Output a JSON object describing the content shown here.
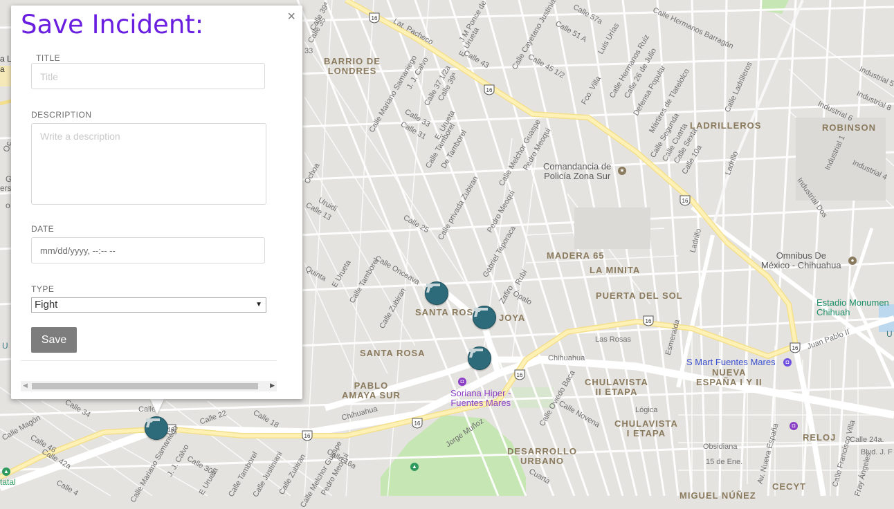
{
  "form": {
    "title": "Save Incident:",
    "close_glyph": "×",
    "title_field": {
      "label": "TITLE",
      "placeholder": "Title"
    },
    "description_field": {
      "label": "DESCRIPTION",
      "placeholder": "Write a description"
    },
    "date_field": {
      "label": "DATE",
      "placeholder": "mm/dd/yyyy, --:-- --"
    },
    "type_field": {
      "label": "TYPE",
      "selected": "Fight"
    },
    "save_label": "Save"
  },
  "markers": {
    "icon": "gun-icon",
    "count": 4,
    "color": "#2e6b7a"
  },
  "map_labels": {
    "neighborhoods": {
      "barrio_de_londres": "BARRIO DE\nLONDRES",
      "ladrilleros": "LADRILLEROS",
      "robinson": "ROBINSON",
      "madera_65": "MADERA 65",
      "la_minita": "LA MINITA",
      "puerta_del_sol": "PUERTA DEL SOL",
      "santa_rosa_1": "SANTA ROSA",
      "joya": "JOYA",
      "santa_rosa_2": "SANTA ROSA",
      "pablo_amaya_sur": "PABLO\nAMAYA SUR",
      "chulavista_ii": "CHULAVISTA\nII ETAPA",
      "chulavista_i": "CHULAVISTA\nI ETAPA",
      "nueva_espana": "NUEVA\nESPAÑA I Y II",
      "desarrollo_urbano": "DESARROLLO\nURBANO",
      "reloj": "RELOJ",
      "cecyt": "CECYT",
      "miguel_nunez": "MIGUEL NÚÑEZ"
    },
    "pois": {
      "comandancia": "Comandancia de\nPolicía Zona Sur",
      "omnibus": "Omnibus De\nMéxico - Chihuahua",
      "estadio": "Estadio Monumen\nChihuah",
      "smart": "S Mart Fuentes Mares",
      "soriana": "Soriana Hiper -\nFuentes Mares"
    },
    "streets": {
      "lat_pacheco": "Lat. Pacheco",
      "calle_39": "Calle 39ª",
      "jm_ponce": "J M Ponce de",
      "e_urueta_top": "E. Urueta",
      "calle_43": "Calle 43",
      "calle_cayetano": "Calle Cayetano Justiniani",
      "calle_45": "Calle 45 1/2",
      "calle_57": "Calle 57a",
      "calle_51a": "Calle 51 A",
      "luis_urias": "Luis Urías",
      "calle_hermanos_ruiz": "Calle Hermanos Ruiz",
      "calle_hermanos_barragan": "Calle Hermanos Barragán",
      "calle_26_julio": "Calle 26 de Julio",
      "defensa_popular": "Defensa Popular",
      "martires": "Mártires de Tlatelolco",
      "fco_villa": "Fco. Villa",
      "calle_mariano": "Calle Mariano Samaniego",
      "j_j_calvo": "J. J. Calvo",
      "calle_37": "Calle 37 1/2a",
      "calle_33": "Calle 33",
      "calle_31": "Calle 31",
      "calle_tamborel": "Calle Tamborel",
      "de_tamborel": "De Tamborel",
      "calle_melchor": "Calle Melchor Guaspe",
      "pedro_meoqui": "Pedro Meoqui",
      "calle_privada": "Calle privada Zubiran",
      "calle_25": "Calle 25",
      "gabriel_teporaca": "Gabriel Teporaca",
      "uruidi": "Uruidi",
      "calle_13": "Calle 13",
      "ochoa": "Ochoa",
      "quinta": "Quinta",
      "calle_onceava": "Calle Onceava",
      "calle_zubiran": "Calle Zubiran",
      "zafiro": "Zafiro",
      "opalo": "Ópalo",
      "rubi": "Rubí",
      "las_rosas": "Las Rosas",
      "chihuahua_1": "Chihuahua",
      "chihuahua_2": "Chihuahua",
      "calle_oviedo": "Calle Oviedo Baca",
      "calle_novena": "Calle Novena",
      "logica": "Lógica",
      "esmeralda": "Esmeralda",
      "juan_pablo": "Juan Pablo II",
      "blvd_j": "Blvd. J. F",
      "calle_segunda": "Calle Segunda",
      "calle_cuarta": "Calle Cuarta",
      "calle_sexta": "Calle Sexta",
      "calle_10a": "Calle 10a",
      "ladrillo_1": "Ladrillo",
      "ladrillo_2": "Ladrillo",
      "calle_ladrilleros": "Calle Ladrilleros",
      "industrial_5": "Industrial 5",
      "industrial_6": "Industrial 6",
      "industrial_8": "Industrial 8",
      "industrial_1": "Industrial 1",
      "industrial_4": "Industrial 4",
      "industrial_dos": "Industrial Dos",
      "jorge_munoz": "Jorge Muñoz",
      "cuarta": "Cuarta",
      "obsidiana": "Obsidiana",
      "15_de_ene": "15 de Ene.",
      "av_nueva_espana": "Av. Nueva España",
      "calle_francisco": "Calle Francisco Villa",
      "calle_24a": "Calle 24a.",
      "fray_angeles": "Fray Ángeles",
      "calle_22": "Calle 22",
      "calle_18": "Calle 18",
      "calle_16a": "Calle 16a",
      "calle_30a": "Calle 30a",
      "calle_zubiran_2": "Calle Zubiran",
      "calle_melchor_2": "Calle Melchor Guaspe",
      "pedro_meoqui_2": "Pedro Meoqui",
      "calle_justiniani": "Calle Justiniani",
      "calle_tamborel_2": "Calle Tamborel",
      "e_urueta_bottom": "E Urueta",
      "calle_34": "Calle 34",
      "calle_42a": "Calle 42a",
      "calle_46": "Calle 46",
      "calle_magon": "Calle Magón",
      "calle_4": "Calle 4",
      "calle_bottom": "Calle",
      "e_urueta_mid": "E Urueta",
      "calle_tamborel_mid": "Calle Tamborel",
      "e_urueta_cuarta": "E. Urueta",
      "calle_39_mid": "Calle 39ª",
      "calle_35": "Calle 35",
      "calle_33_left": "33"
    },
    "highway_shield": "16",
    "left_edge": [
      "a La",
      "a",
      "Oc",
      "G",
      "ers",
      "o",
      "U",
      "tatal"
    ]
  }
}
